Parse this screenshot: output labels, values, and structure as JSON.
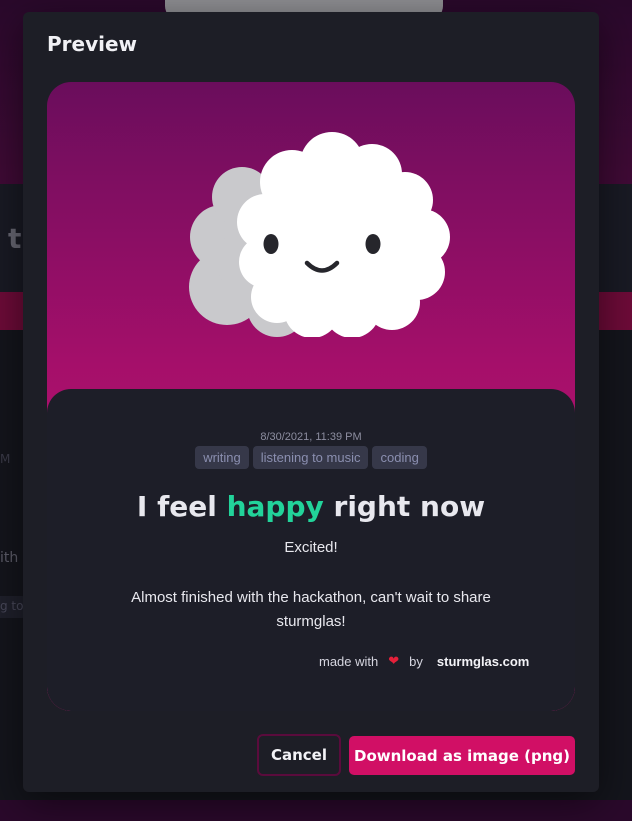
{
  "background": {
    "partial_letter": "t",
    "fragment_time": "M",
    "fragment_text": "ith",
    "fragment_tag": "g to"
  },
  "modal": {
    "title": "Preview",
    "card": {
      "illustration": "happy-cloud-icon",
      "timestamp": "8/30/2021, 11:39 PM",
      "tags": [
        "writing",
        "listening to music",
        "coding"
      ],
      "feeling_prefix": "I feel",
      "mood": "happy",
      "feeling_suffix": "right now",
      "mood_color": "#22d39a",
      "subtitle": "Excited!",
      "note": "Almost finished with the hackathon, can't wait to share sturmglas!",
      "footer": {
        "made_with": "made with",
        "heart_icon": "heart-icon",
        "by": "by",
        "brand": "sturmglas.com"
      }
    },
    "buttons": {
      "cancel": "Cancel",
      "download": "Download as image (png)"
    }
  },
  "colors": {
    "accent": "#d10f65",
    "mood_green": "#22d39a",
    "heart": "#e5203a"
  }
}
